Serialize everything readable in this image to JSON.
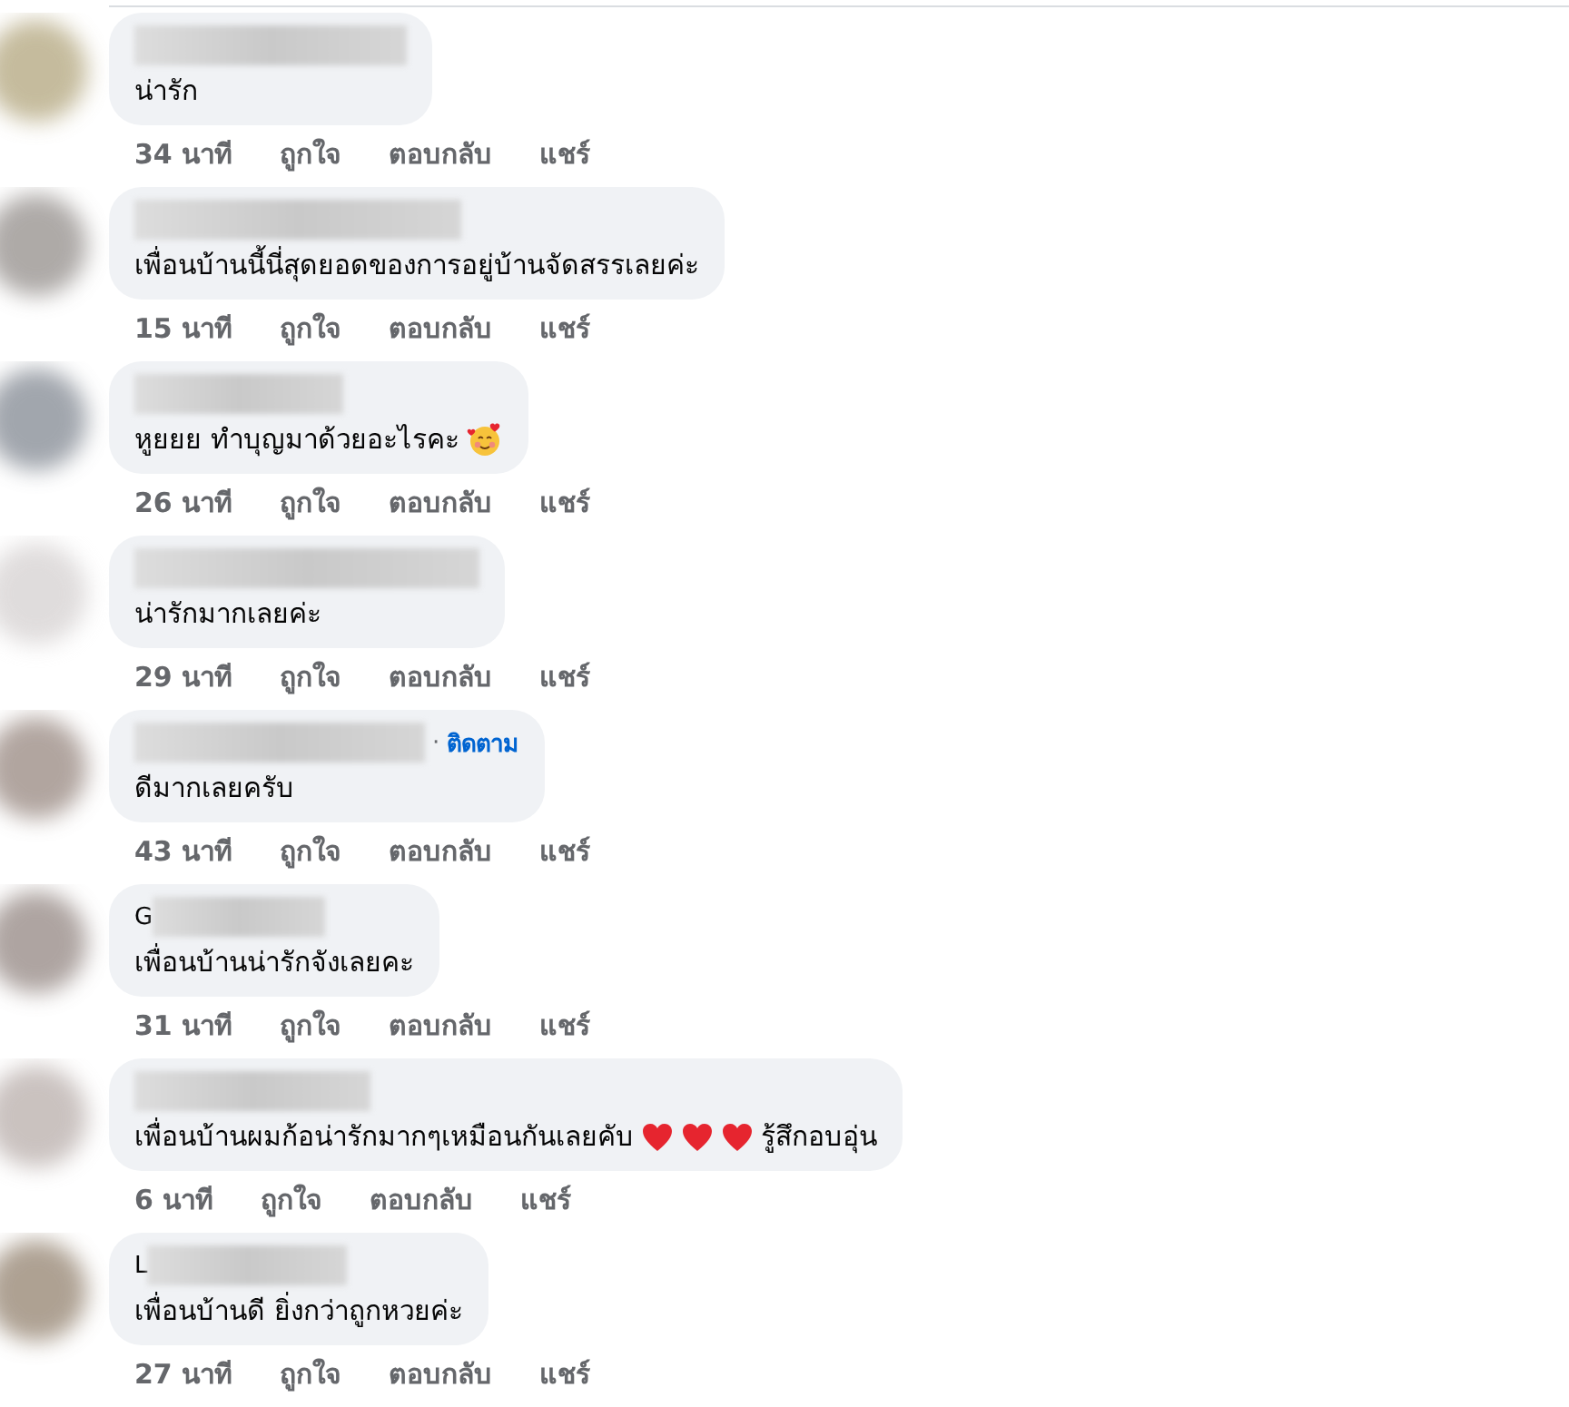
{
  "comments": [
    {
      "parts": [
        {
          "kind": "text",
          "text": "น่ารัก"
        }
      ],
      "time": "34 นาที",
      "actions": [
        "ถูกใจ",
        "ตอบกลับ",
        "แชร์"
      ]
    },
    {
      "parts": [
        {
          "kind": "text",
          "text": "เพื่อนบ้านนี้นี่สุดยอดของการอยู่บ้านจัดสรรเลยค่ะ"
        }
      ],
      "time": "15 นาที",
      "actions": [
        "ถูกใจ",
        "ตอบกลับ",
        "แชร์"
      ]
    },
    {
      "parts": [
        {
          "kind": "text",
          "text": "หูยยย ทำบุญมาด้วยอะไรคะ"
        },
        {
          "kind": "hearts-face"
        }
      ],
      "time": "26 นาที",
      "actions": [
        "ถูกใจ",
        "ตอบกลับ",
        "แชร์"
      ]
    },
    {
      "parts": [
        {
          "kind": "text",
          "text": "น่ารักมากเลยค่ะ"
        }
      ],
      "time": "29 นาที",
      "actions": [
        "ถูกใจ",
        "ตอบกลับ",
        "แชร์"
      ]
    },
    {
      "separator": "·",
      "follow": "ติดตาม",
      "parts": [
        {
          "kind": "text",
          "text": "ดีมากเลยครับ"
        }
      ],
      "time": "43 นาที",
      "actions": [
        "ถูกใจ",
        "ตอบกลับ",
        "แชร์"
      ]
    },
    {
      "name_prefix": "G",
      "parts": [
        {
          "kind": "text",
          "text": "เพื่อนบ้านน่ารักจังเลยคะ"
        }
      ],
      "time": "31 นาที",
      "actions": [
        "ถูกใจ",
        "ตอบกลับ",
        "แชร์"
      ]
    },
    {
      "parts": [
        {
          "kind": "text",
          "text": "เพื่อนบ้านผมก้อน่ารักมากๆเหมือนกันเลยคับ"
        },
        {
          "kind": "heart"
        },
        {
          "kind": "heart"
        },
        {
          "kind": "heart"
        },
        {
          "kind": "text",
          "text": "รู้สึกอบอุ่น"
        }
      ],
      "time": "6 นาที",
      "actions": [
        "ถูกใจ",
        "ตอบกลับ",
        "แชร์"
      ]
    },
    {
      "name_prefix": "L",
      "parts": [
        {
          "kind": "text",
          "text": "เพื่อนบ้านดี ยิ่งกว่าถูกหวยค่ะ"
        }
      ],
      "time": "27 นาที",
      "actions": [
        "ถูกใจ",
        "ตอบกลับ",
        "แชร์"
      ]
    }
  ]
}
